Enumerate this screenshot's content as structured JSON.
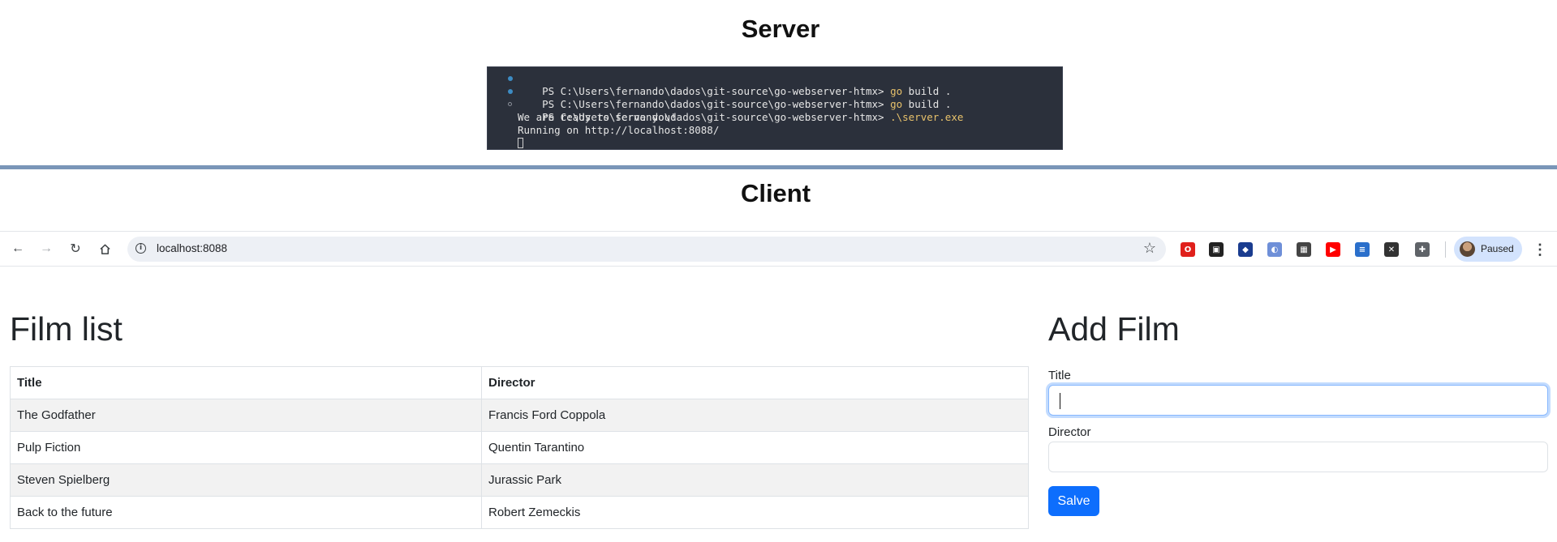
{
  "sections": {
    "server_title": "Server",
    "client_title": "Client"
  },
  "terminal": {
    "lines": [
      {
        "status": "done",
        "prompt": "PS C:\\Users\\fernando\\dados\\git-source\\go-webserver-htmx> ",
        "command": "go",
        "rest": " build ."
      },
      {
        "status": "done",
        "prompt": "PS C:\\Users\\fernando\\dados\\git-source\\go-webserver-htmx> ",
        "command": "go",
        "rest": " build ."
      },
      {
        "status": "running",
        "prompt": "PS C:\\Users\\fernando\\dados\\git-source\\go-webserver-htmx> ",
        "command": ".\\server.exe",
        "rest": ""
      },
      {
        "status": "output",
        "text": "We are ready to serve you!"
      },
      {
        "status": "output",
        "text": "Running on http://localhost:8088/"
      }
    ]
  },
  "browser": {
    "url": "localhost:8088",
    "profile_label": "Paused",
    "nav_icons": [
      "back-arrow-icon",
      "forward-arrow-icon",
      "reload-icon",
      "home-icon"
    ],
    "extensions": [
      {
        "name": "opera-icon",
        "color": "#e0201b",
        "glyph": "O"
      },
      {
        "name": "mask-extension-icon",
        "color": "#222222",
        "glyph": "▣"
      },
      {
        "name": "shield-extension-icon",
        "color": "#1a3c8f",
        "glyph": "◆"
      },
      {
        "name": "globe-extension-icon",
        "color": "#6e8fd8",
        "glyph": "◐"
      },
      {
        "name": "qr-code-icon",
        "color": "#444444",
        "glyph": "▦"
      },
      {
        "name": "youtube-icon",
        "color": "#ff0000",
        "glyph": "▶"
      },
      {
        "name": "layers-extension-icon",
        "color": "#2a6fcb",
        "glyph": "≡"
      },
      {
        "name": "x-extension-icon",
        "color": "#333333",
        "glyph": "✕"
      },
      {
        "name": "puzzle-extensions-icon",
        "color": "#5f6368",
        "glyph": "✚"
      }
    ]
  },
  "film_list": {
    "heading": "Film list",
    "columns": [
      "Title",
      "Director"
    ],
    "rows": [
      [
        "The Godfather",
        "Francis Ford Coppola"
      ],
      [
        "Pulp Fiction",
        "Quentin Tarantino"
      ],
      [
        "Steven Spielberg",
        "Jurassic Park"
      ],
      [
        "Back to the future",
        "Robert Zemeckis"
      ]
    ]
  },
  "add_film": {
    "heading": "Add Film",
    "title_label": "Title",
    "title_value": "",
    "director_label": "Director",
    "director_value": "",
    "submit_label": "Salve"
  },
  "colors": {
    "primary": "#0d6efd",
    "terminal_bg": "#2b303b",
    "divider": "#7a96b8"
  }
}
